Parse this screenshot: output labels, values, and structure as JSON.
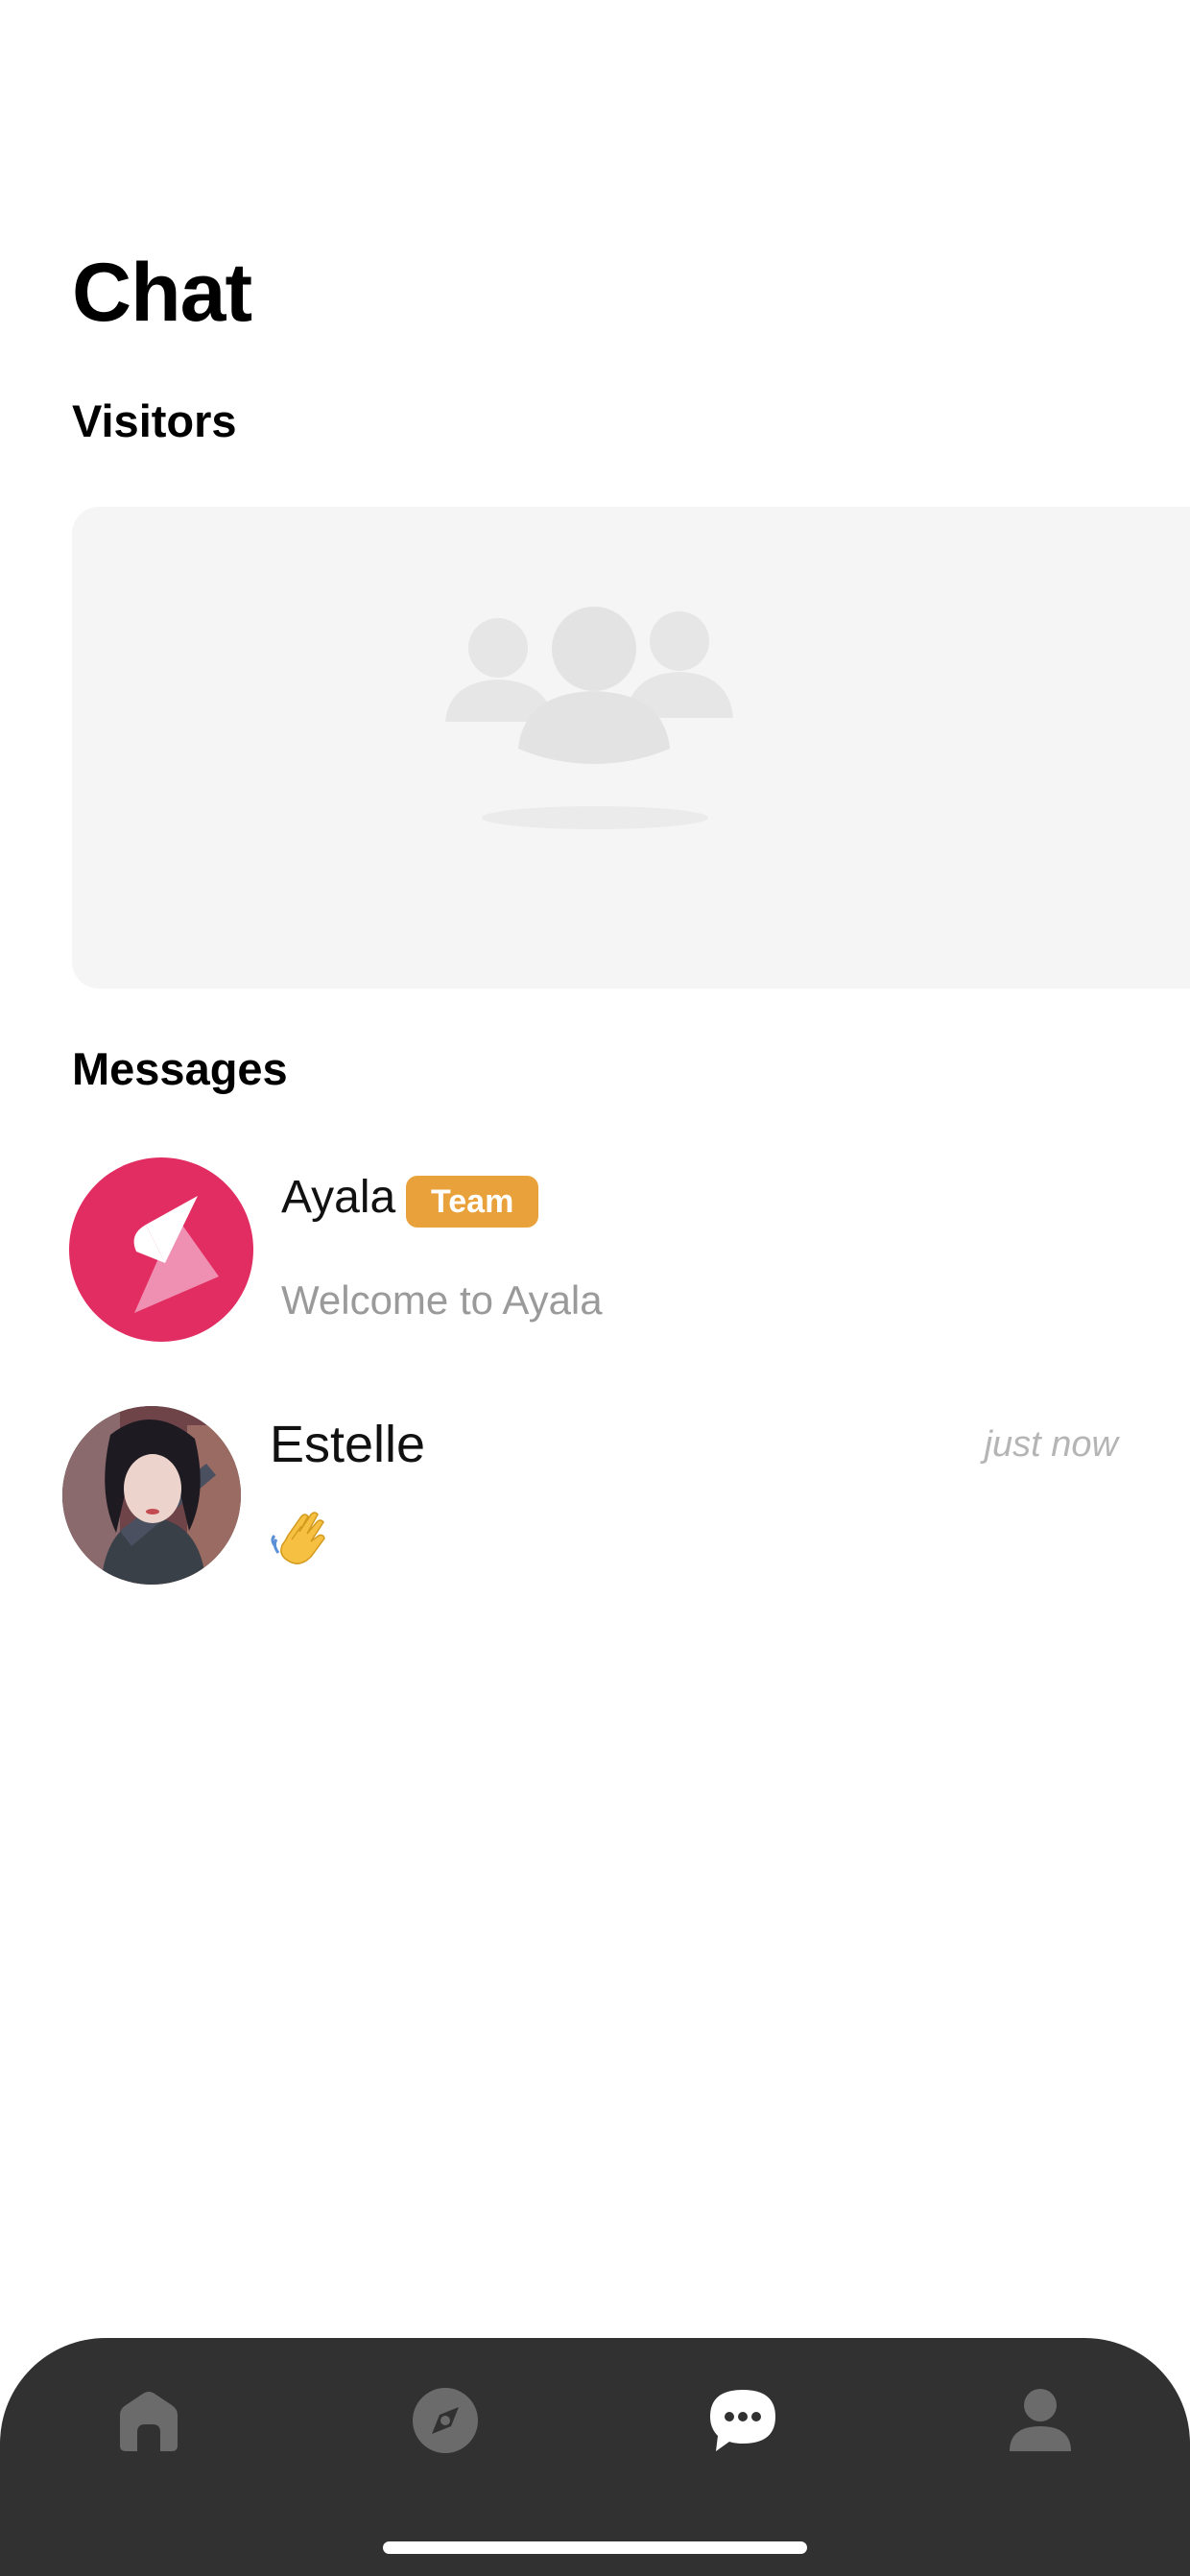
{
  "page": {
    "title": "Chat"
  },
  "sections": {
    "visitors": "Visitors",
    "messages": "Messages"
  },
  "messages": [
    {
      "name": "Ayala",
      "badge": "Team",
      "preview": "Welcome to Ayala",
      "time": ""
    },
    {
      "name": "Estelle",
      "badge": "",
      "preview_icon": "waving-hand-emoji",
      "time": "just now"
    }
  ],
  "tabs": [
    {
      "icon": "home-icon",
      "active": false
    },
    {
      "icon": "compass-icon",
      "active": false
    },
    {
      "icon": "chat-bubble-icon",
      "active": true
    },
    {
      "icon": "user-icon",
      "active": false
    }
  ],
  "colors": {
    "ayala_brand": "#e22d62",
    "team_badge": "#e9a23b",
    "tab_bar": "#313131",
    "tab_inactive": "#6b6b6b",
    "tab_active": "#ffffff"
  }
}
